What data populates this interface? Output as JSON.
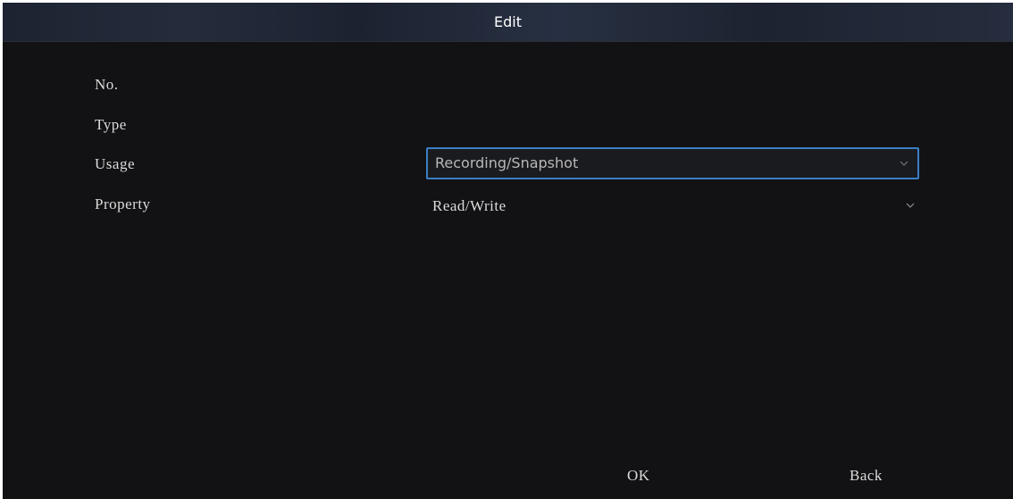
{
  "dialog": {
    "title": "Edit"
  },
  "fields": {
    "no": {
      "label": "No."
    },
    "type": {
      "label": "Type"
    },
    "usage": {
      "label": "Usage",
      "value": "Recording/Snapshot"
    },
    "property": {
      "label": "Property",
      "value": "Read/Write"
    }
  },
  "buttons": {
    "ok": "OK",
    "back": "Back"
  },
  "icons": {
    "usage_dropdown": "chevron-down-icon",
    "property_dropdown": "chevron-down-icon"
  },
  "colors": {
    "background": "#121214",
    "accent_border": "#3a7fc4",
    "text": "#dcdcdc"
  }
}
